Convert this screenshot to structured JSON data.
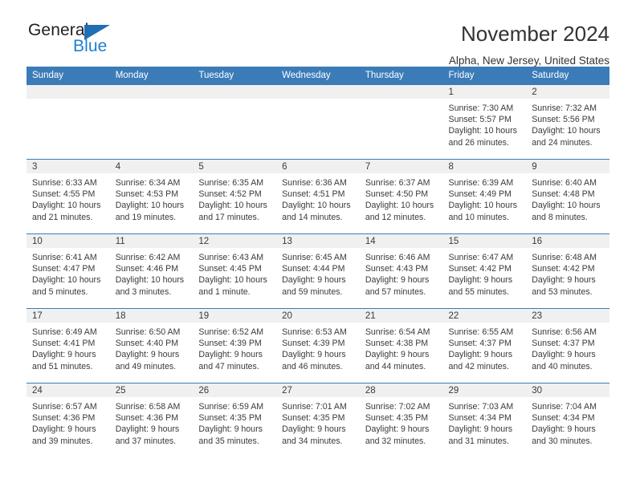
{
  "brand": {
    "name_part1": "General",
    "name_part2": "Blue",
    "triangle_icon": "triangle-icon",
    "accent_color": "#1f7fd0",
    "header_color": "#3b7cb8"
  },
  "header": {
    "title": "November 2024",
    "subtitle": "Alpha, New Jersey, United States"
  },
  "calendar": {
    "weekday_headers": [
      "Sunday",
      "Monday",
      "Tuesday",
      "Wednesday",
      "Thursday",
      "Friday",
      "Saturday"
    ],
    "weeks": [
      [
        {
          "day": "",
          "empty": true
        },
        {
          "day": "",
          "empty": true
        },
        {
          "day": "",
          "empty": true
        },
        {
          "day": "",
          "empty": true
        },
        {
          "day": "",
          "empty": true
        },
        {
          "day": "1",
          "sunrise": "Sunrise: 7:30 AM",
          "sunset": "Sunset: 5:57 PM",
          "daylight1": "Daylight: 10 hours",
          "daylight2": "and 26 minutes."
        },
        {
          "day": "2",
          "sunrise": "Sunrise: 7:32 AM",
          "sunset": "Sunset: 5:56 PM",
          "daylight1": "Daylight: 10 hours",
          "daylight2": "and 24 minutes."
        }
      ],
      [
        {
          "day": "3",
          "sunrise": "Sunrise: 6:33 AM",
          "sunset": "Sunset: 4:55 PM",
          "daylight1": "Daylight: 10 hours",
          "daylight2": "and 21 minutes."
        },
        {
          "day": "4",
          "sunrise": "Sunrise: 6:34 AM",
          "sunset": "Sunset: 4:53 PM",
          "daylight1": "Daylight: 10 hours",
          "daylight2": "and 19 minutes."
        },
        {
          "day": "5",
          "sunrise": "Sunrise: 6:35 AM",
          "sunset": "Sunset: 4:52 PM",
          "daylight1": "Daylight: 10 hours",
          "daylight2": "and 17 minutes."
        },
        {
          "day": "6",
          "sunrise": "Sunrise: 6:36 AM",
          "sunset": "Sunset: 4:51 PM",
          "daylight1": "Daylight: 10 hours",
          "daylight2": "and 14 minutes."
        },
        {
          "day": "7",
          "sunrise": "Sunrise: 6:37 AM",
          "sunset": "Sunset: 4:50 PM",
          "daylight1": "Daylight: 10 hours",
          "daylight2": "and 12 minutes."
        },
        {
          "day": "8",
          "sunrise": "Sunrise: 6:39 AM",
          "sunset": "Sunset: 4:49 PM",
          "daylight1": "Daylight: 10 hours",
          "daylight2": "and 10 minutes."
        },
        {
          "day": "9",
          "sunrise": "Sunrise: 6:40 AM",
          "sunset": "Sunset: 4:48 PM",
          "daylight1": "Daylight: 10 hours",
          "daylight2": "and 8 minutes."
        }
      ],
      [
        {
          "day": "10",
          "sunrise": "Sunrise: 6:41 AM",
          "sunset": "Sunset: 4:47 PM",
          "daylight1": "Daylight: 10 hours",
          "daylight2": "and 5 minutes."
        },
        {
          "day": "11",
          "sunrise": "Sunrise: 6:42 AM",
          "sunset": "Sunset: 4:46 PM",
          "daylight1": "Daylight: 10 hours",
          "daylight2": "and 3 minutes."
        },
        {
          "day": "12",
          "sunrise": "Sunrise: 6:43 AM",
          "sunset": "Sunset: 4:45 PM",
          "daylight1": "Daylight: 10 hours",
          "daylight2": "and 1 minute."
        },
        {
          "day": "13",
          "sunrise": "Sunrise: 6:45 AM",
          "sunset": "Sunset: 4:44 PM",
          "daylight1": "Daylight: 9 hours",
          "daylight2": "and 59 minutes."
        },
        {
          "day": "14",
          "sunrise": "Sunrise: 6:46 AM",
          "sunset": "Sunset: 4:43 PM",
          "daylight1": "Daylight: 9 hours",
          "daylight2": "and 57 minutes."
        },
        {
          "day": "15",
          "sunrise": "Sunrise: 6:47 AM",
          "sunset": "Sunset: 4:42 PM",
          "daylight1": "Daylight: 9 hours",
          "daylight2": "and 55 minutes."
        },
        {
          "day": "16",
          "sunrise": "Sunrise: 6:48 AM",
          "sunset": "Sunset: 4:42 PM",
          "daylight1": "Daylight: 9 hours",
          "daylight2": "and 53 minutes."
        }
      ],
      [
        {
          "day": "17",
          "sunrise": "Sunrise: 6:49 AM",
          "sunset": "Sunset: 4:41 PM",
          "daylight1": "Daylight: 9 hours",
          "daylight2": "and 51 minutes."
        },
        {
          "day": "18",
          "sunrise": "Sunrise: 6:50 AM",
          "sunset": "Sunset: 4:40 PM",
          "daylight1": "Daylight: 9 hours",
          "daylight2": "and 49 minutes."
        },
        {
          "day": "19",
          "sunrise": "Sunrise: 6:52 AM",
          "sunset": "Sunset: 4:39 PM",
          "daylight1": "Daylight: 9 hours",
          "daylight2": "and 47 minutes."
        },
        {
          "day": "20",
          "sunrise": "Sunrise: 6:53 AM",
          "sunset": "Sunset: 4:39 PM",
          "daylight1": "Daylight: 9 hours",
          "daylight2": "and 46 minutes."
        },
        {
          "day": "21",
          "sunrise": "Sunrise: 6:54 AM",
          "sunset": "Sunset: 4:38 PM",
          "daylight1": "Daylight: 9 hours",
          "daylight2": "and 44 minutes."
        },
        {
          "day": "22",
          "sunrise": "Sunrise: 6:55 AM",
          "sunset": "Sunset: 4:37 PM",
          "daylight1": "Daylight: 9 hours",
          "daylight2": "and 42 minutes."
        },
        {
          "day": "23",
          "sunrise": "Sunrise: 6:56 AM",
          "sunset": "Sunset: 4:37 PM",
          "daylight1": "Daylight: 9 hours",
          "daylight2": "and 40 minutes."
        }
      ],
      [
        {
          "day": "24",
          "sunrise": "Sunrise: 6:57 AM",
          "sunset": "Sunset: 4:36 PM",
          "daylight1": "Daylight: 9 hours",
          "daylight2": "and 39 minutes."
        },
        {
          "day": "25",
          "sunrise": "Sunrise: 6:58 AM",
          "sunset": "Sunset: 4:36 PM",
          "daylight1": "Daylight: 9 hours",
          "daylight2": "and 37 minutes."
        },
        {
          "day": "26",
          "sunrise": "Sunrise: 6:59 AM",
          "sunset": "Sunset: 4:35 PM",
          "daylight1": "Daylight: 9 hours",
          "daylight2": "and 35 minutes."
        },
        {
          "day": "27",
          "sunrise": "Sunrise: 7:01 AM",
          "sunset": "Sunset: 4:35 PM",
          "daylight1": "Daylight: 9 hours",
          "daylight2": "and 34 minutes."
        },
        {
          "day": "28",
          "sunrise": "Sunrise: 7:02 AM",
          "sunset": "Sunset: 4:35 PM",
          "daylight1": "Daylight: 9 hours",
          "daylight2": "and 32 minutes."
        },
        {
          "day": "29",
          "sunrise": "Sunrise: 7:03 AM",
          "sunset": "Sunset: 4:34 PM",
          "daylight1": "Daylight: 9 hours",
          "daylight2": "and 31 minutes."
        },
        {
          "day": "30",
          "sunrise": "Sunrise: 7:04 AM",
          "sunset": "Sunset: 4:34 PM",
          "daylight1": "Daylight: 9 hours",
          "daylight2": "and 30 minutes."
        }
      ]
    ]
  }
}
